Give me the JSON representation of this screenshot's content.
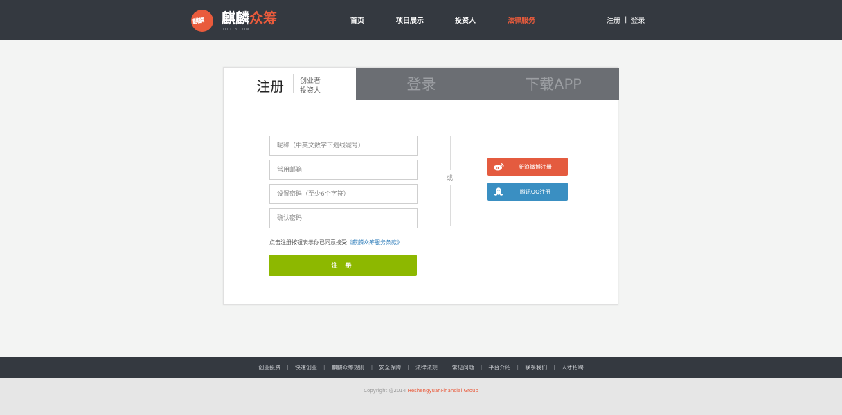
{
  "header": {
    "logo_badge": "麒麟",
    "logo_name_a": "麒麟",
    "logo_name_b": "众筹",
    "logo_sub": "TOU78.COM",
    "nav": [
      {
        "label": "首页",
        "active": false
      },
      {
        "label": "项目展示",
        "active": false
      },
      {
        "label": "投资人",
        "active": false
      },
      {
        "label": "法律服务",
        "active": true
      }
    ],
    "auth_register": "注册",
    "auth_sep": "|",
    "auth_login": "登录"
  },
  "tabs": {
    "register": "注册",
    "register_opt1": "创业者",
    "register_opt2": "投资人",
    "login": "登录",
    "app": "下载APP"
  },
  "form": {
    "nickname_placeholder": "昵称（中英文数字下划线减号）",
    "email_placeholder": "常用邮箱",
    "password_placeholder": "设置密码（至少6个字符）",
    "confirm_placeholder": "确认密码",
    "agree_text": "点击注册按钮表示你已同意接受",
    "agree_link": "《麒麟众筹服务条款》",
    "submit": "注 册"
  },
  "divider_text": "或",
  "social": {
    "weibo": "新浪微博注册",
    "qq": "腾讯QQ注册"
  },
  "footer": {
    "links": [
      "创业投资",
      "快速创业",
      "麒麟众筹规则",
      "安全保障",
      "法律法规",
      "常见问题",
      "平台介绍",
      "联系我们",
      "人才招聘"
    ],
    "sep": "|",
    "copyright": "Copyright @2014 ",
    "company": "HeshengyuanFinancial Group"
  },
  "colors": {
    "header_bg": "#343940",
    "accent": "#e95b3c",
    "submit_green": "#8db800",
    "weibo_red": "#e45b3f",
    "qq_blue": "#3a8fc2",
    "tab_gray": "#6b6e73"
  }
}
